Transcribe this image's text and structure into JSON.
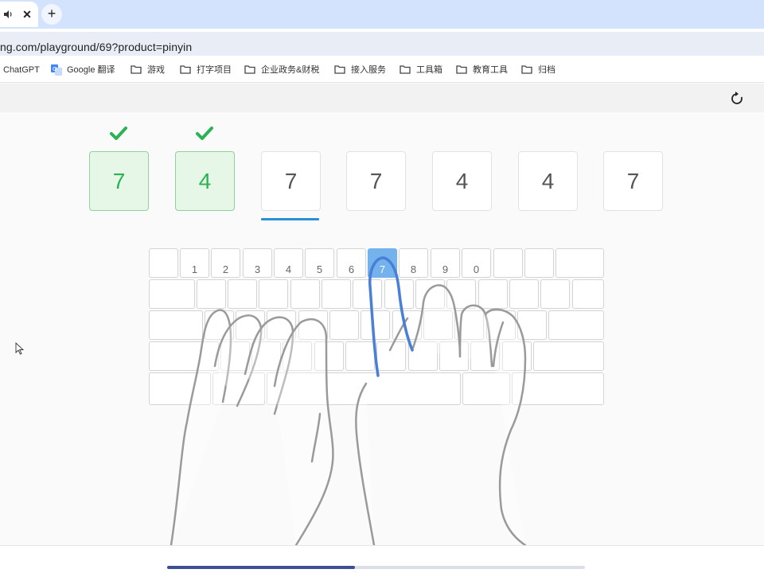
{
  "browser": {
    "tab_close": "✕",
    "new_tab": "+",
    "url": "ng.com/playground/69?product=pinyin"
  },
  "bookmarks": [
    {
      "label": "ChatGPT",
      "icon": "none"
    },
    {
      "label": "Google 翻译",
      "icon": "google-translate-icon"
    },
    {
      "label": "游戏",
      "icon": "folder-icon"
    },
    {
      "label": "打字项目",
      "icon": "folder-icon"
    },
    {
      "label": "企业政务&财税",
      "icon": "folder-icon"
    },
    {
      "label": "接入服务",
      "icon": "folder-icon"
    },
    {
      "label": "工具箱",
      "icon": "folder-icon"
    },
    {
      "label": "教育工具",
      "icon": "folder-icon"
    },
    {
      "label": "归档",
      "icon": "folder-icon"
    }
  ],
  "sequence": [
    {
      "char": "7",
      "status": "done"
    },
    {
      "char": "4",
      "status": "done"
    },
    {
      "char": "7",
      "status": "current"
    },
    {
      "char": "7",
      "status": "pending"
    },
    {
      "char": "4",
      "status": "pending"
    },
    {
      "char": "4",
      "status": "pending"
    },
    {
      "char": "7",
      "status": "pending"
    }
  ],
  "keyboard": {
    "number_row": [
      "",
      "1",
      "2",
      "3",
      "4",
      "5",
      "6",
      "7",
      "8",
      "9",
      "0",
      "",
      "",
      ""
    ],
    "highlighted_key": "7"
  },
  "progress": 0.45,
  "colors": {
    "done_green": "#2bb255",
    "highlight_blue": "#74b2ee",
    "progress_blue": "#3c4f95",
    "cursor_line": "#2a8fd6"
  }
}
